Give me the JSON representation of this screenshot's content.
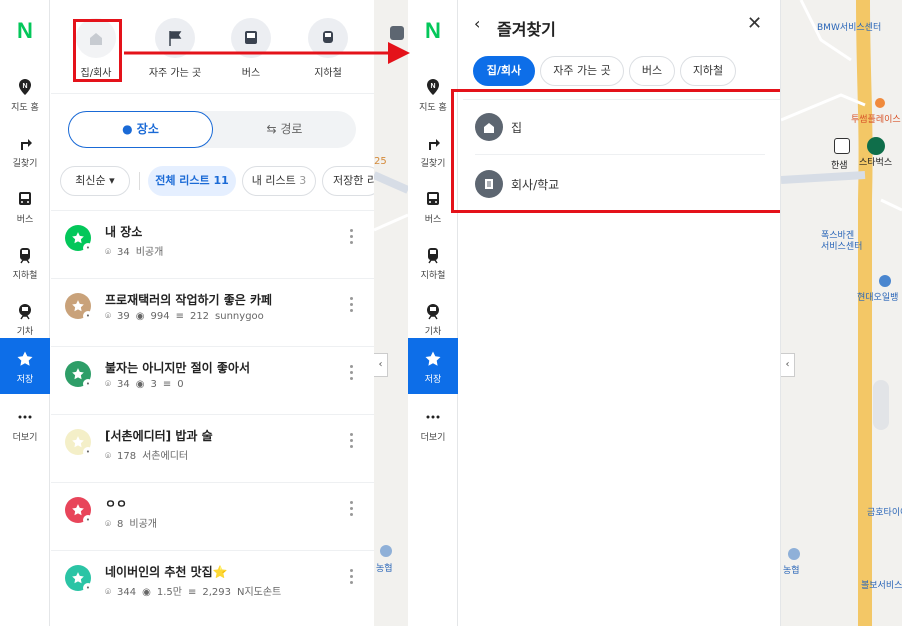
{
  "left": {
    "nav": {
      "logo": "N",
      "items": [
        {
          "label": "지도 홈",
          "icon": "map-pin-icon"
        },
        {
          "label": "길찾기",
          "icon": "directions-icon"
        },
        {
          "label": "버스",
          "icon": "bus-icon"
        },
        {
          "label": "지하철",
          "icon": "subway-icon"
        },
        {
          "label": "기차",
          "icon": "train-icon"
        },
        {
          "label": "저장",
          "icon": "star-icon",
          "active": true
        },
        {
          "label": "더보기",
          "icon": "more-icon"
        }
      ]
    },
    "quick": [
      {
        "label": "집/회사"
      },
      {
        "label": "자주 가는 곳"
      },
      {
        "label": "버스"
      },
      {
        "label": "지하철"
      }
    ],
    "tabs": {
      "place": "장소",
      "route": "경로"
    },
    "sort": "최신순",
    "filters": {
      "all_label": "전체 리스트",
      "all_count": "11",
      "mine_label": "내 리스트",
      "mine_count": "3",
      "saved_label": "저장한 리"
    },
    "lists": [
      {
        "title": "내 장소",
        "pins": "34",
        "privacy": "비공개",
        "color": "#03c75a"
      },
      {
        "title": "프로재택러의 작업하기 좋은 카페",
        "pins": "39",
        "views": "994",
        "saves": "212",
        "author": "sunnygoo",
        "color": "#c9a27a"
      },
      {
        "title": "불자는 아니지만 절이 좋아서",
        "pins": "34",
        "views": "3",
        "saves": "0",
        "color": "#2e9e68"
      },
      {
        "title": "[서촌에디터] 밥과 술",
        "pins": "178",
        "author": "서촌에디터",
        "color": "#f4efc8"
      },
      {
        "title": "ㅇㅇ",
        "pins": "8",
        "privacy": "비공개",
        "color": "#e8455a"
      },
      {
        "title": "네이버인의 추천 맛집⭐",
        "pins": "344",
        "views": "1.5만",
        "saves": "2,293",
        "author": "N지도손트",
        "color": "#2bc4a5"
      }
    ]
  },
  "right": {
    "nav": {
      "logo": "N",
      "items": [
        {
          "label": "지도 홈"
        },
        {
          "label": "길찾기"
        },
        {
          "label": "버스"
        },
        {
          "label": "지하철"
        },
        {
          "label": "기차"
        },
        {
          "label": "저장"
        },
        {
          "label": "더보기"
        }
      ]
    },
    "panel": {
      "title": "즐겨찾기",
      "tabs": [
        "집/회사",
        "자주 가는 곳",
        "버스",
        "지하철"
      ],
      "entries": [
        {
          "label": "집",
          "icon": "home-icon"
        },
        {
          "label": "회사/학교",
          "icon": "building-icon"
        }
      ]
    },
    "map_labels": {
      "bmw": "BMW서비스센터",
      "twosome": "투썸플레이스",
      "hansam": "한샘",
      "starbucks": "스타벅스",
      "foxbaguette": "폭스바겐",
      "foxservice": "서비스센터",
      "hyundai": "현대오일뱅",
      "kumho": "금호타이어",
      "nonghyup": "농협",
      "bosch": "볼보서비스"
    }
  },
  "left_map": {
    "num": "25",
    "nonghyup": "농협"
  },
  "colors": {
    "accent": "#0d6ee8",
    "brand": "#03c75a",
    "highlight": "#e4121a"
  }
}
